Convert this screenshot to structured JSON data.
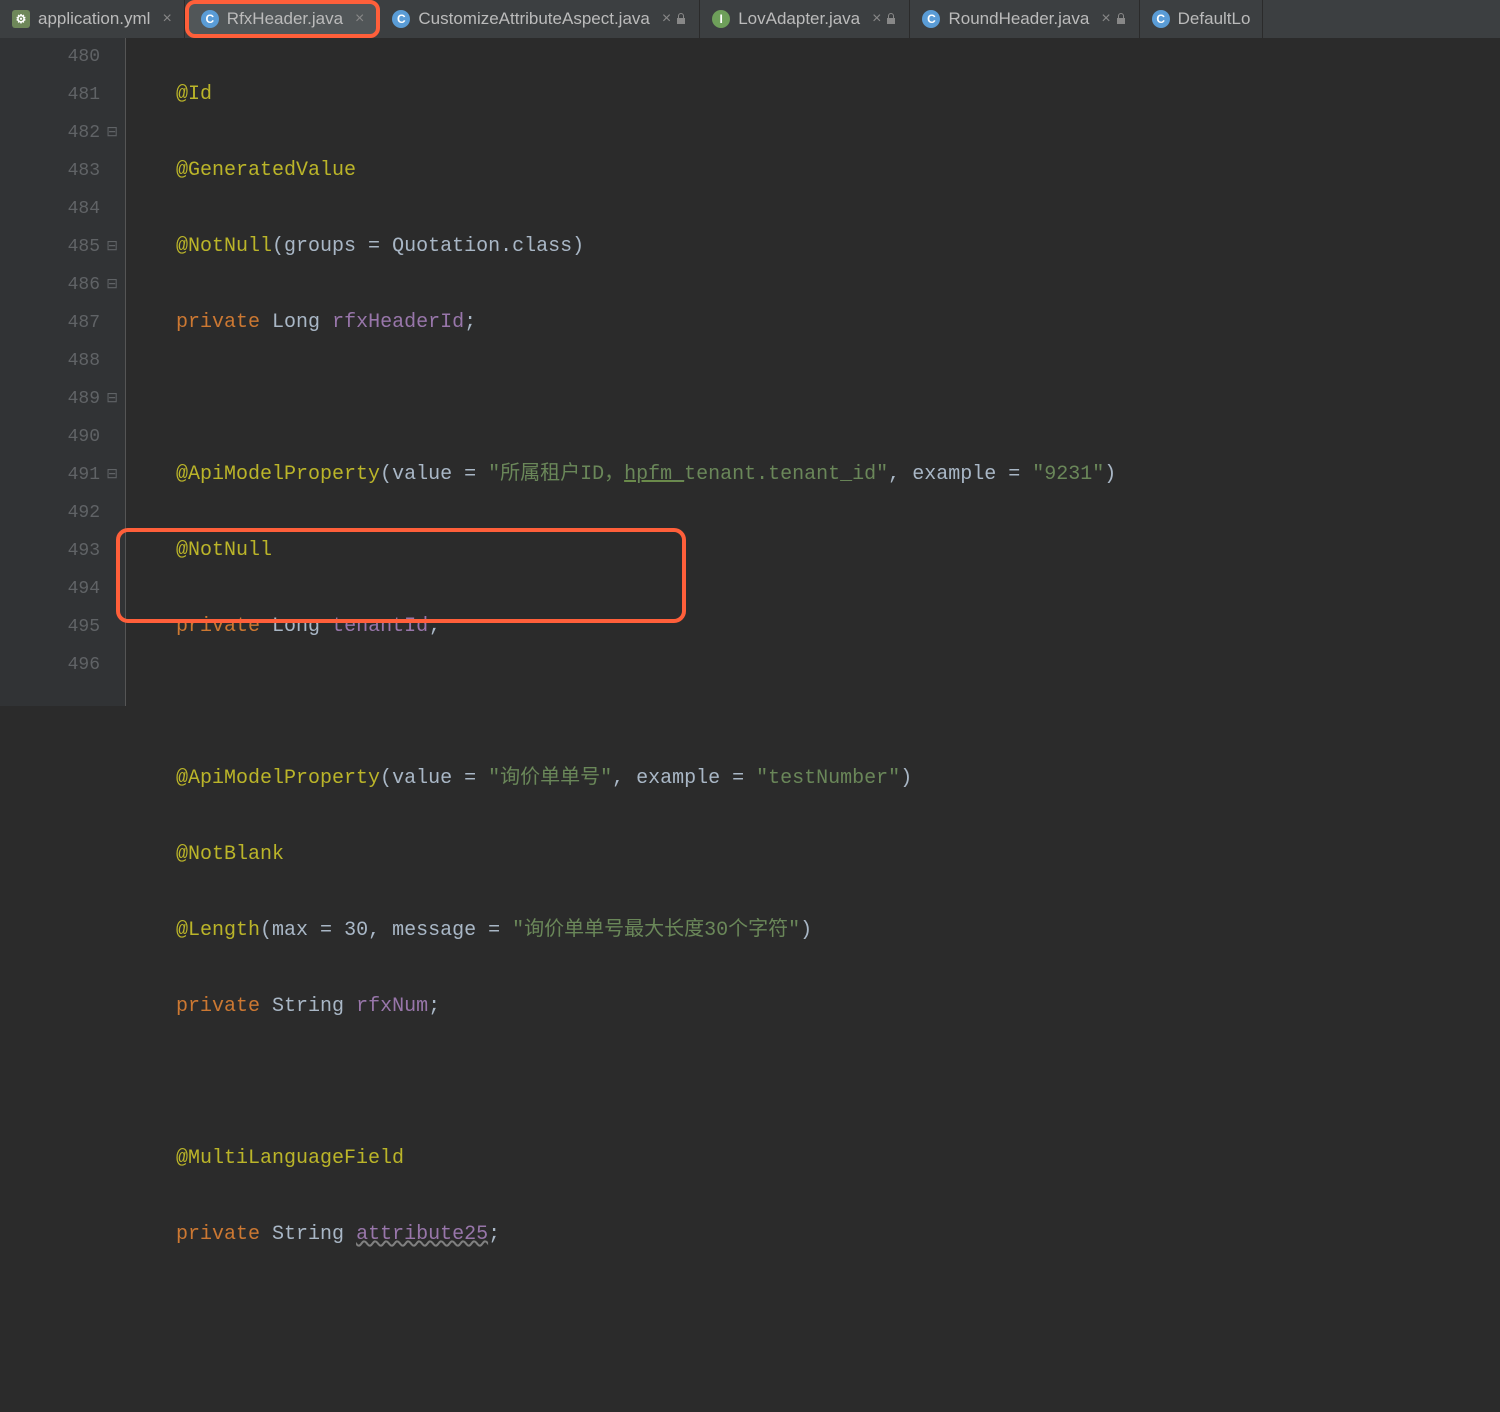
{
  "tabs": [
    {
      "label": "application.yml",
      "icon": "yml",
      "active": false,
      "locked": false
    },
    {
      "label": "RfxHeader.java",
      "icon": "java",
      "active": true,
      "locked": false,
      "highlighted": true
    },
    {
      "label": "CustomizeAttributeAspect.java",
      "icon": "java",
      "active": false,
      "locked": true
    },
    {
      "label": "LovAdapter.java",
      "icon": "intf",
      "active": false,
      "locked": true
    },
    {
      "label": "RoundHeader.java",
      "icon": "java",
      "active": false,
      "locked": true
    },
    {
      "label": "DefaultLo",
      "icon": "java",
      "active": false,
      "locked": true
    }
  ],
  "lines": {
    "start": 480,
    "count": 17
  },
  "code": {
    "l480": {
      "ann": "@Id"
    },
    "l481": {
      "ann": "@GeneratedValue"
    },
    "l482": {
      "ann": "@NotNull",
      "param": "groups",
      "val": "Quotation",
      "cls": ".class"
    },
    "l483": {
      "kw": "private",
      "type": "Long",
      "name": "rfxHeaderId"
    },
    "l485": {
      "ann": "@ApiModelProperty",
      "p1": "value",
      "v1": "\"所属租户ID，hpfm_tenant.tenant_id\"",
      "p2": "example",
      "v2": "\"9231\"",
      "und": "hpfm_"
    },
    "l486": {
      "ann": "@NotNull"
    },
    "l487": {
      "kw": "private",
      "type": "Long",
      "name": "tenantId"
    },
    "l489": {
      "ann": "@ApiModelProperty",
      "p1": "value",
      "v1": "\"询价单单号\"",
      "p2": "example",
      "v2": "\"testNumber\""
    },
    "l490": {
      "ann": "@NotBlank"
    },
    "l491": {
      "ann": "@Length",
      "p1": "max",
      "v1": "30",
      "p2": "message",
      "v2": "\"询价单单号最大长度30个字符\""
    },
    "l492": {
      "kw": "private",
      "type": "String",
      "name": "rfxNum"
    },
    "l494": {
      "ann": "@MultiLanguageField"
    },
    "l495": {
      "kw": "private",
      "type": "String",
      "name": "attribute25"
    }
  }
}
